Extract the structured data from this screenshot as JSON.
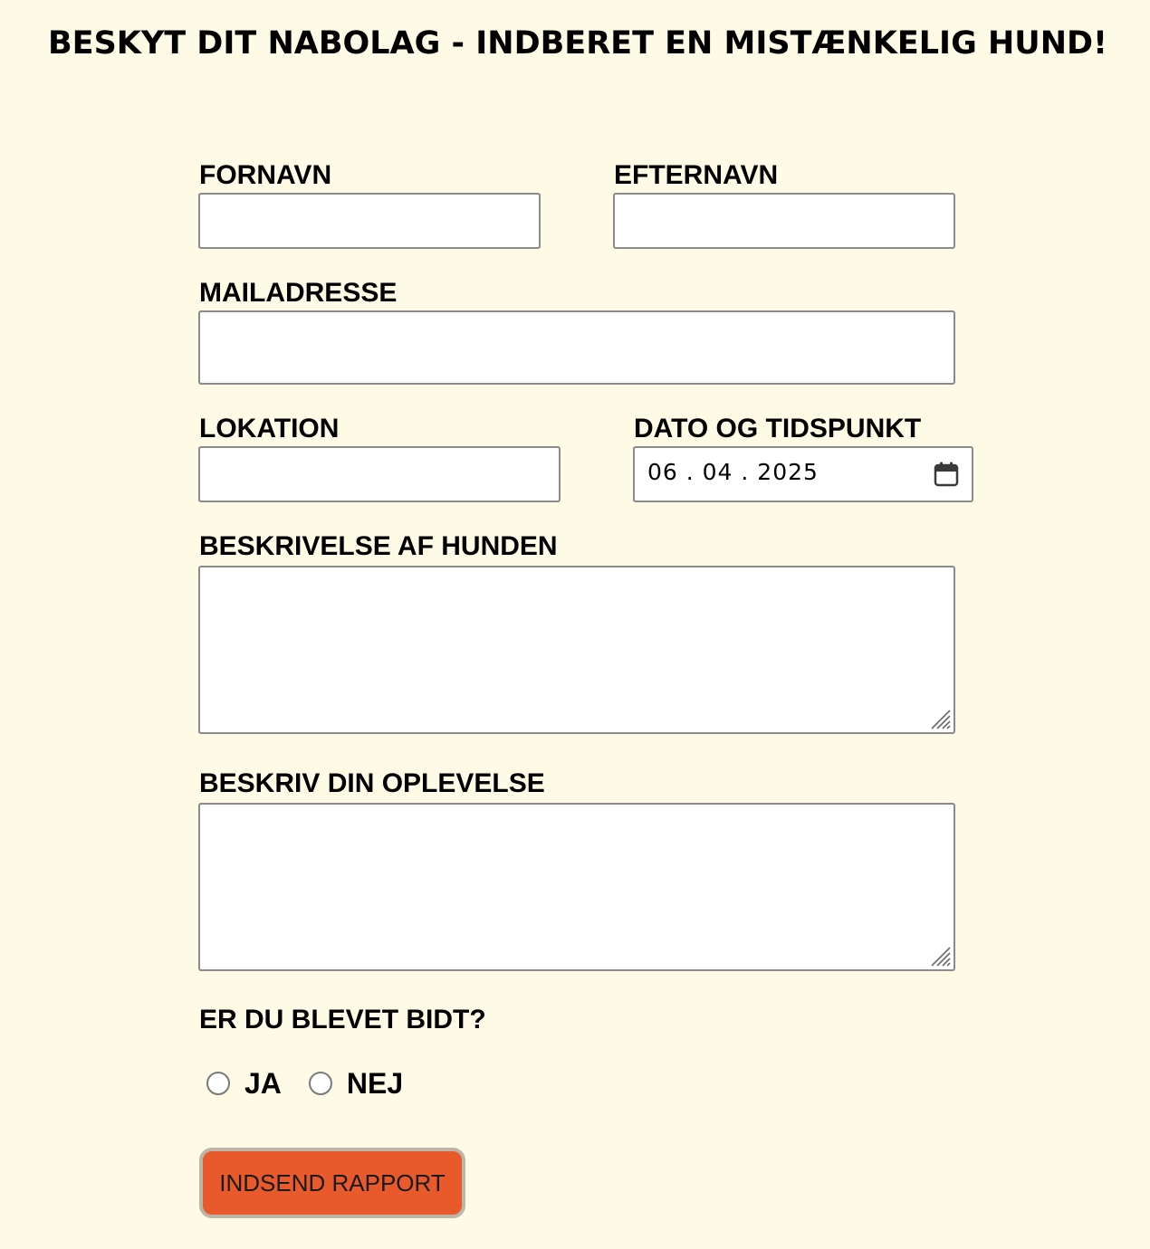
{
  "header": {
    "title": "BESKYT DIT NABOLAG - INDBERET EN MISTÆNKELIG HUND!"
  },
  "form": {
    "first_name": {
      "label": "FORNAVN",
      "value": ""
    },
    "last_name": {
      "label": "EFTERNAVN",
      "value": ""
    },
    "email": {
      "label": "MAILADRESSE",
      "value": ""
    },
    "location": {
      "label": "LOKATION",
      "value": ""
    },
    "datetime": {
      "label": "DATO OG TIDSPUNKT",
      "value": "06 . 04 . 2025",
      "icon": "calendar-icon"
    },
    "dog_description": {
      "label": "BESKRIVELSE AF HUNDEN",
      "value": ""
    },
    "experience": {
      "label": "BESKRIV DIN OPLEVELSE",
      "value": ""
    },
    "bitten": {
      "question": "ER DU BLEVET BIDT?",
      "options": [
        "JA",
        "NEJ"
      ],
      "selected": null
    },
    "submit_label": "INDSEND RAPPORT"
  },
  "colors": {
    "background": "#fdfae5",
    "button": "#e85a2c",
    "field_border": "#8a8a8a"
  }
}
